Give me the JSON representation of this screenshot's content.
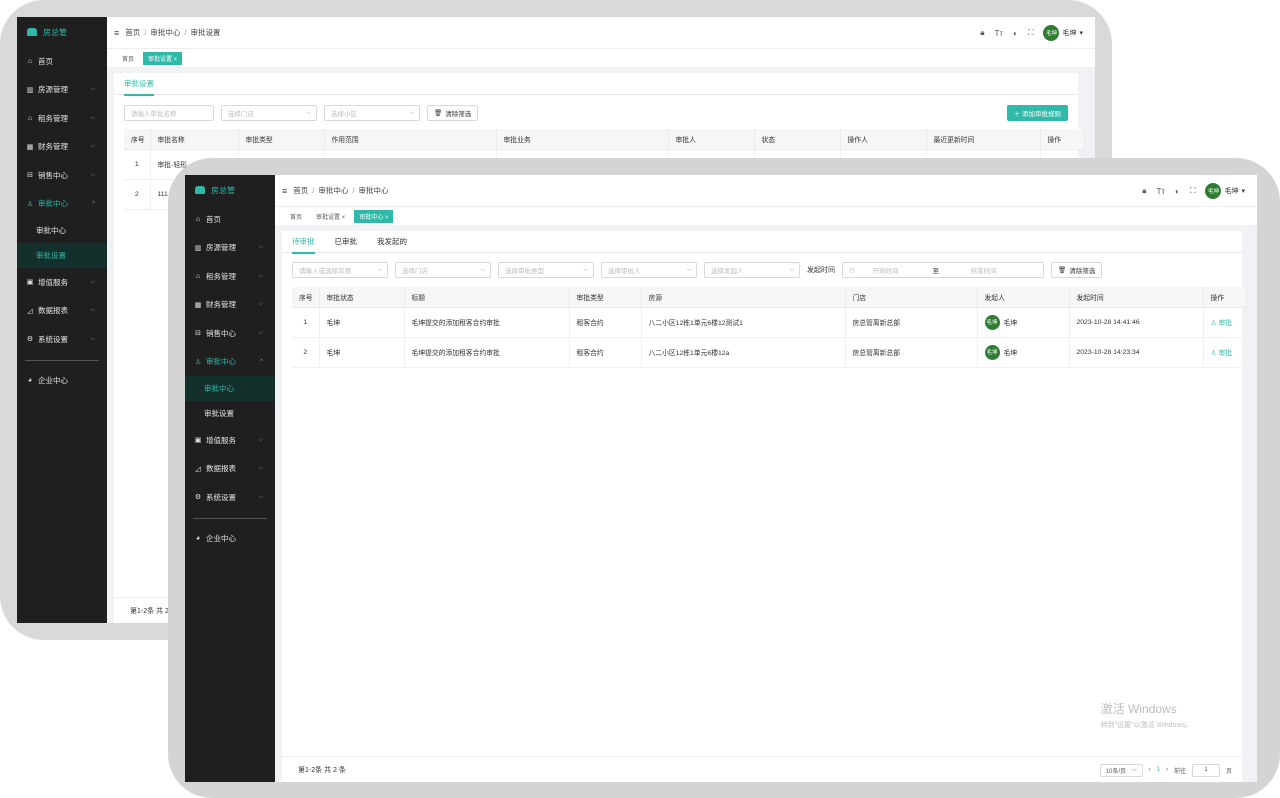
{
  "app": {
    "logo_text": "房总管",
    "user_name": "毛坤",
    "avatar_text": "毛坤"
  },
  "sidebar_back": {
    "items": [
      {
        "label": "首页",
        "icon": "⌂"
      },
      {
        "label": "房源管理",
        "icon": "▥"
      },
      {
        "label": "租务管理",
        "icon": "⌂"
      },
      {
        "label": "财务管理",
        "icon": "▦"
      },
      {
        "label": "销售中心",
        "icon": "⊟"
      },
      {
        "label": "审批中心",
        "icon": "♙"
      }
    ],
    "subitems": [
      "审批中心",
      "审批设置"
    ],
    "items2": [
      {
        "label": "增值服务",
        "icon": "▣"
      },
      {
        "label": "数据报表",
        "icon": "◿"
      },
      {
        "label": "系统设置",
        "icon": "⚙"
      }
    ],
    "enterprise": "企业中心"
  },
  "back": {
    "breadcrumb": [
      "首页",
      "审批中心",
      "审批设置"
    ],
    "tags": [
      "首页",
      "审批设置 ×"
    ],
    "tab": "审批设置",
    "filters": [
      "请输入审批名称",
      "选择门店",
      "选择小区"
    ],
    "clear_btn": "清除筛选",
    "add_btn": "＋ 添加审批规则",
    "columns": [
      "序号",
      "审批名称",
      "审批类型",
      "作用范围",
      "审批业务",
      "审批人",
      "状态",
      "操作人",
      "最近更新时间",
      "操作"
    ],
    "rows": [
      {
        "idx": "1",
        "name": "审批-轻形"
      },
      {
        "idx": "2",
        "name": "111"
      }
    ],
    "footer": "第1-2条 共 2"
  },
  "front": {
    "breadcrumb": [
      "首页",
      "审批中心",
      "审批中心"
    ],
    "tags": [
      "首页",
      "审批设置 ×",
      "审批中心 ×"
    ],
    "tabs": [
      "待审批",
      "已审批",
      "我发起的"
    ],
    "filters": [
      "请输入或选择房源",
      "选择门店",
      "选择审批类型",
      "选择审批人",
      "选择发起人"
    ],
    "date_label": "发起时间",
    "date_start": "开始时间",
    "date_to": "至",
    "date_end": "结束时间",
    "clear_btn": "清除筛选",
    "columns": [
      "序号",
      "审批状态",
      "标题",
      "审批类型",
      "房源",
      "门店",
      "发起人",
      "发起时间",
      "操作"
    ],
    "rows": [
      {
        "idx": "1",
        "status": "毛坤",
        "title": "毛坤提交的添加租客合约审批",
        "type": "租客合约",
        "house": "八二小区12栋1单元6楼12测试1",
        "store": "房总管离新总部",
        "initiator": "毛坤",
        "time": "2023-10-28 14:41:46",
        "action": "审批"
      },
      {
        "idx": "2",
        "status": "毛坤",
        "title": "毛坤提交的添加租客合约审批",
        "type": "租客合约",
        "house": "八二小区12栋1单元6楼12a",
        "store": "房总管离新总部",
        "initiator": "毛坤",
        "time": "2023-10-28 14:23:34",
        "action": "审批"
      }
    ],
    "footer": "第1-2条 共 2 条",
    "page_size": "10条/页",
    "page_current": "1",
    "goto_label": "前往",
    "goto_value": "1",
    "page_unit": "页"
  },
  "watermark": {
    "line1": "激活 Windows",
    "line2": "转到\"设置\"以激活 Windows。"
  },
  "colors": {
    "accent": "#2fb9a8",
    "sidebar": "#1f1f1f",
    "avatar": "#2e7d32"
  }
}
